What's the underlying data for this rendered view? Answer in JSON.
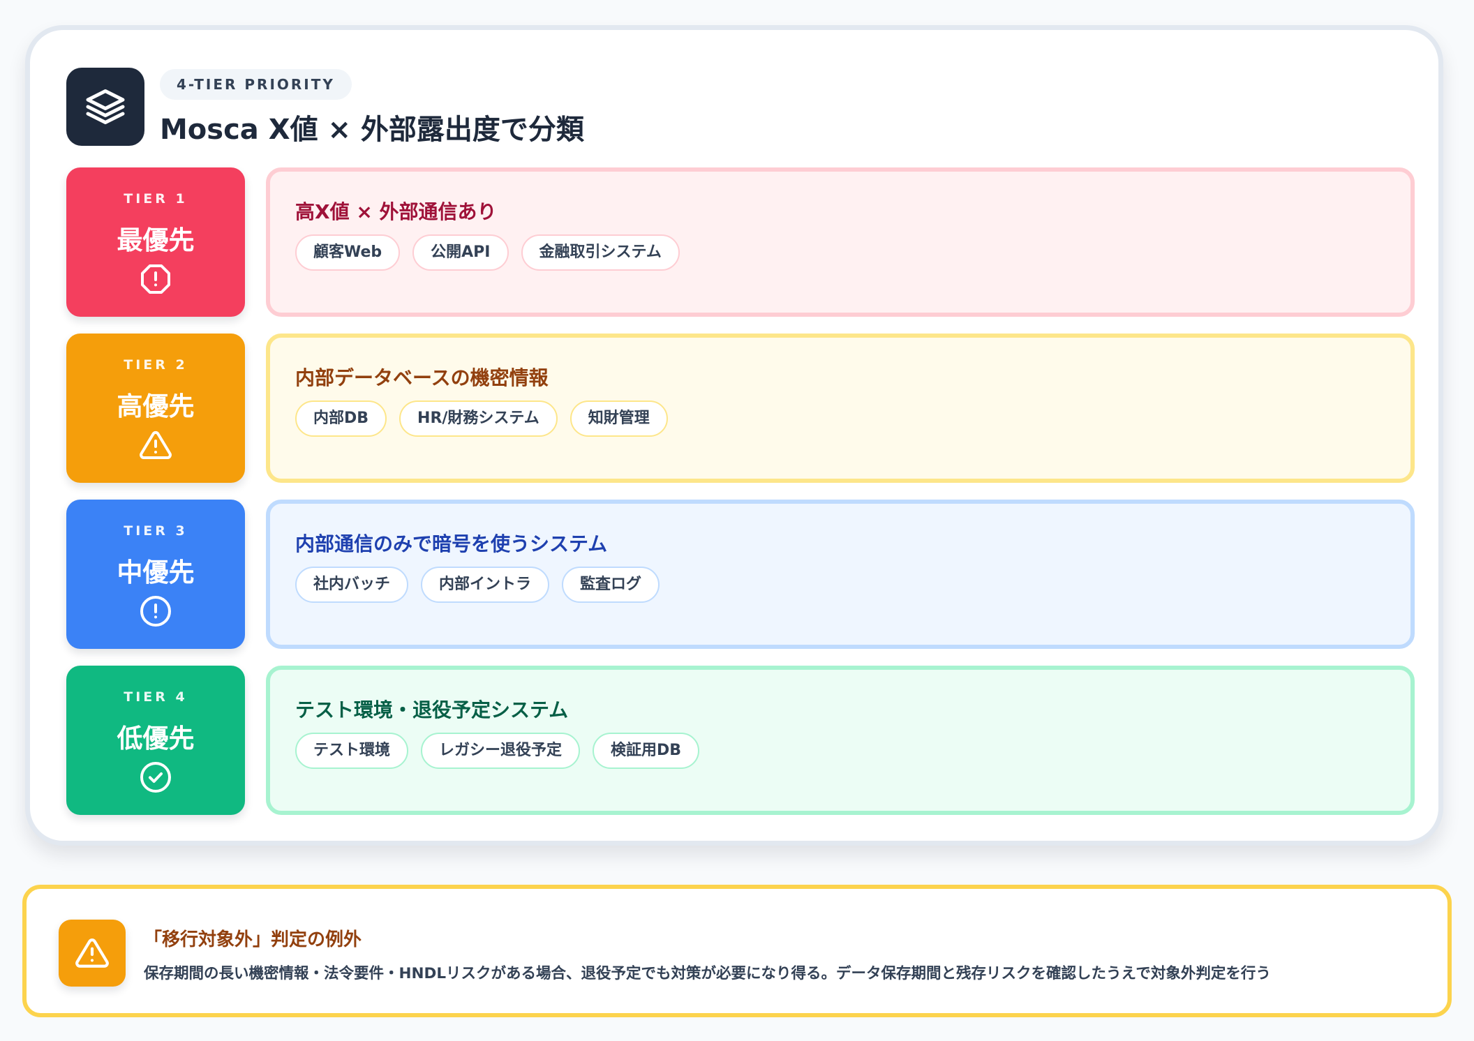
{
  "header": {
    "kicker": "4-TIER PRIORITY",
    "title": "Mosca X値 × 外部露出度で分類",
    "logo_icon": "layers-icon"
  },
  "tiers": [
    {
      "label": "TIER 1",
      "priority": "最優先",
      "icon": "alert-octagon-icon",
      "color": "#f43f5e",
      "heading": "高X値 × 外部通信あり",
      "chips": [
        "顧客Web",
        "公開API",
        "金融取引システム"
      ]
    },
    {
      "label": "TIER 2",
      "priority": "高優先",
      "icon": "warning-triangle-icon",
      "color": "#f59e0b",
      "heading": "内部データベースの機密情報",
      "chips": [
        "内部DB",
        "HR/財務システム",
        "知財管理"
      ]
    },
    {
      "label": "TIER 3",
      "priority": "中優先",
      "icon": "alert-circle-icon",
      "color": "#3b82f6",
      "heading": "内部通信のみで暗号を使うシステム",
      "chips": [
        "社内バッチ",
        "内部イントラ",
        "監査ログ"
      ]
    },
    {
      "label": "TIER 4",
      "priority": "低優先",
      "icon": "check-circle-icon",
      "color": "#10b981",
      "heading": "テスト環境・退役予定システム",
      "chips": [
        "テスト環境",
        "レガシー退役予定",
        "検証用DB"
      ]
    }
  ],
  "note": {
    "icon": "warning-triangle-icon",
    "title": "「移行対象外」判定の例外",
    "body": "保存期間の長い機密情報・法令要件・HNDLリスクがある場合、退役予定でも対策が必要になり得る。データ保存期間と残存リスクを確認したうえで対象外判定を行う"
  }
}
